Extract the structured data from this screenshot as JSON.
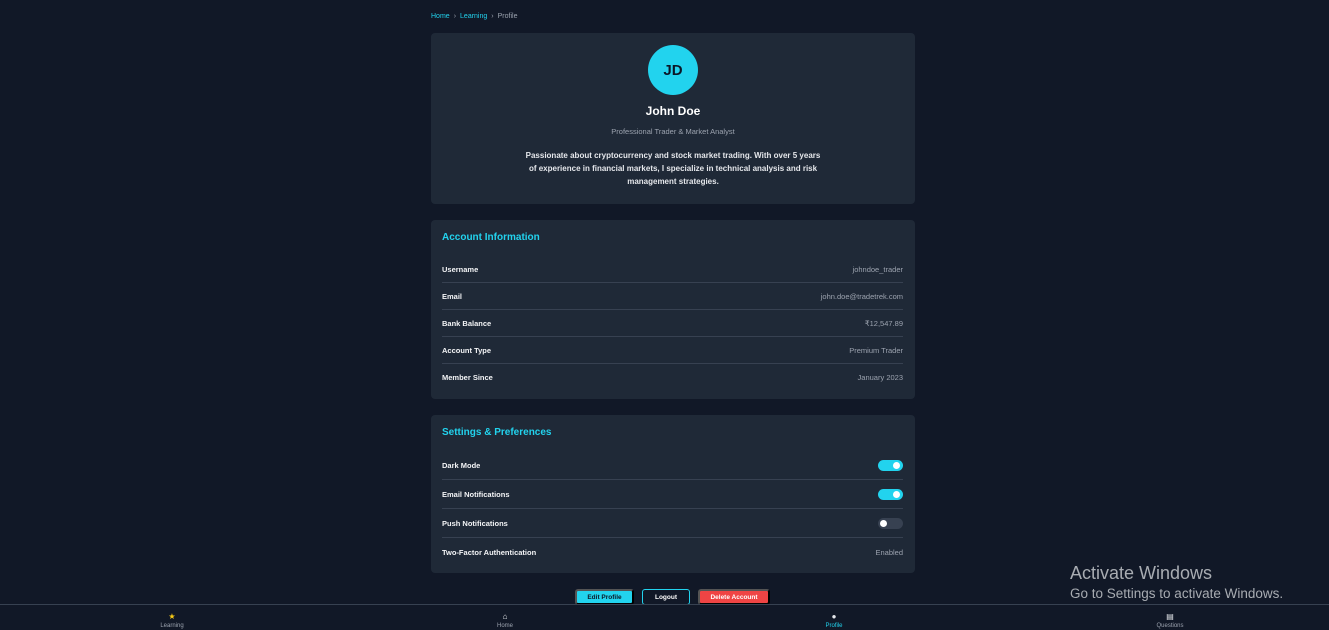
{
  "breadcrumb": {
    "home": "Home",
    "learning": "Learning",
    "current": "Profile",
    "separator": "›"
  },
  "profile": {
    "initials": "JD",
    "name": "John Doe",
    "title": "Professional Trader & Market Analyst",
    "bio": "Passionate about cryptocurrency and stock market trading. With over 5 years of experience in financial markets, I specialize in technical analysis and risk management strategies."
  },
  "account": {
    "title": "Account Information",
    "rows": [
      {
        "label": "Username",
        "value": "johndoe_trader"
      },
      {
        "label": "Email",
        "value": "john.doe@tradetrek.com"
      },
      {
        "label": "Bank Balance",
        "value": "₹12,547.89"
      },
      {
        "label": "Account Type",
        "value": "Premium Trader"
      },
      {
        "label": "Member Since",
        "value": "January 2023"
      }
    ]
  },
  "settings": {
    "title": "Settings & Preferences",
    "rows": [
      {
        "label": "Dark Mode",
        "enabled": true
      },
      {
        "label": "Email Notifications",
        "enabled": true
      },
      {
        "label": "Push Notifications",
        "enabled": false
      },
      {
        "label": "Two-Factor Authentication",
        "value": "Enabled"
      }
    ]
  },
  "actions": {
    "edit": "Edit Profile",
    "logout": "Logout",
    "delete": "Delete Account"
  },
  "nav": [
    {
      "icon": "★",
      "icon_name": "star-icon",
      "label": "Learning",
      "color": "#facc15"
    },
    {
      "icon": "⌂",
      "icon_name": "home-icon",
      "label": "Home",
      "color": "#e5e7eb"
    },
    {
      "icon": "●",
      "icon_name": "user-icon",
      "label": "Profile",
      "color": "#e5e7eb",
      "active": true
    },
    {
      "icon": "▤",
      "icon_name": "clipboard-icon",
      "label": "Questions",
      "color": "#e5e7eb"
    }
  ],
  "watermark": {
    "title": "Activate Windows",
    "subtitle": "Go to Settings to activate Windows."
  },
  "colors": {
    "accent": "#22d3ee",
    "danger": "#ef4444",
    "background": "#111827",
    "card": "#1f2937"
  }
}
